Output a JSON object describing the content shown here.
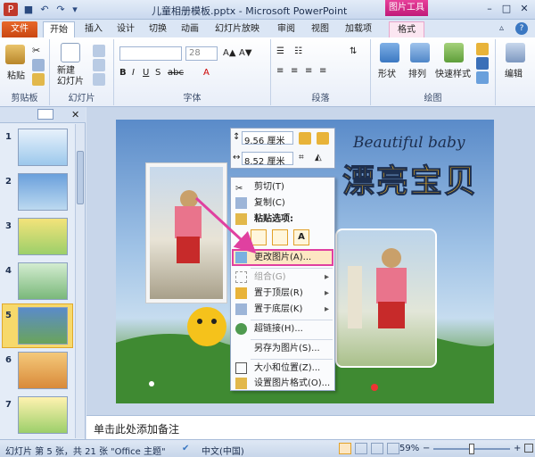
{
  "window": {
    "title": "儿童相册模板.pptx - Microsoft PowerPoint",
    "context_tools": "图片工具"
  },
  "tabs": [
    "文件",
    "开始",
    "插入",
    "设计",
    "切换",
    "动画",
    "幻灯片放映",
    "审阅",
    "视图",
    "加载项",
    "格式"
  ],
  "ribbon": {
    "paste": "粘贴",
    "new_slide": "新建\n幻灯片",
    "groups": [
      "剪贴板",
      "幻灯片",
      "字体",
      "段落",
      "绘图"
    ],
    "font_size": "28",
    "shape": "形状",
    "arrange": "排列",
    "quick_style": "快速样式",
    "edit": "编辑"
  },
  "slides_pane": {
    "thumb_numbers": [
      "1",
      "2",
      "3",
      "4",
      "5",
      "6",
      "7"
    ],
    "selected": 5
  },
  "mini_toolbar": {
    "height": "9.56 厘米",
    "width": "8.52 厘米"
  },
  "slide_text": {
    "title_en": "Beautiful baby",
    "title_cn": "漂亮宝贝"
  },
  "context_menu": {
    "cut": "剪切(T)",
    "copy": "复制(C)",
    "paste_options": "粘贴选项:",
    "change_picture": "更改图片(A)...",
    "group": "组合(G)",
    "bring_front": "置于顶层(R)",
    "send_back": "置于底层(K)",
    "hyperlink": "超链接(H)...",
    "save_as_picture": "另存为图片(S)...",
    "size_position": "大小和位置(Z)...",
    "format_picture": "设置图片格式(O)..."
  },
  "notes": {
    "placeholder": "单击此处添加备注"
  },
  "status": {
    "slide_info": "幻灯片 第 5 张，共 21 张",
    "theme": "\"Office 主题\"",
    "language": "中文(中国)",
    "zoom": "59%"
  },
  "colors": {
    "highlight": "#e040a0",
    "file_tab": "#d4541b",
    "context_tools": "#d6257f"
  }
}
